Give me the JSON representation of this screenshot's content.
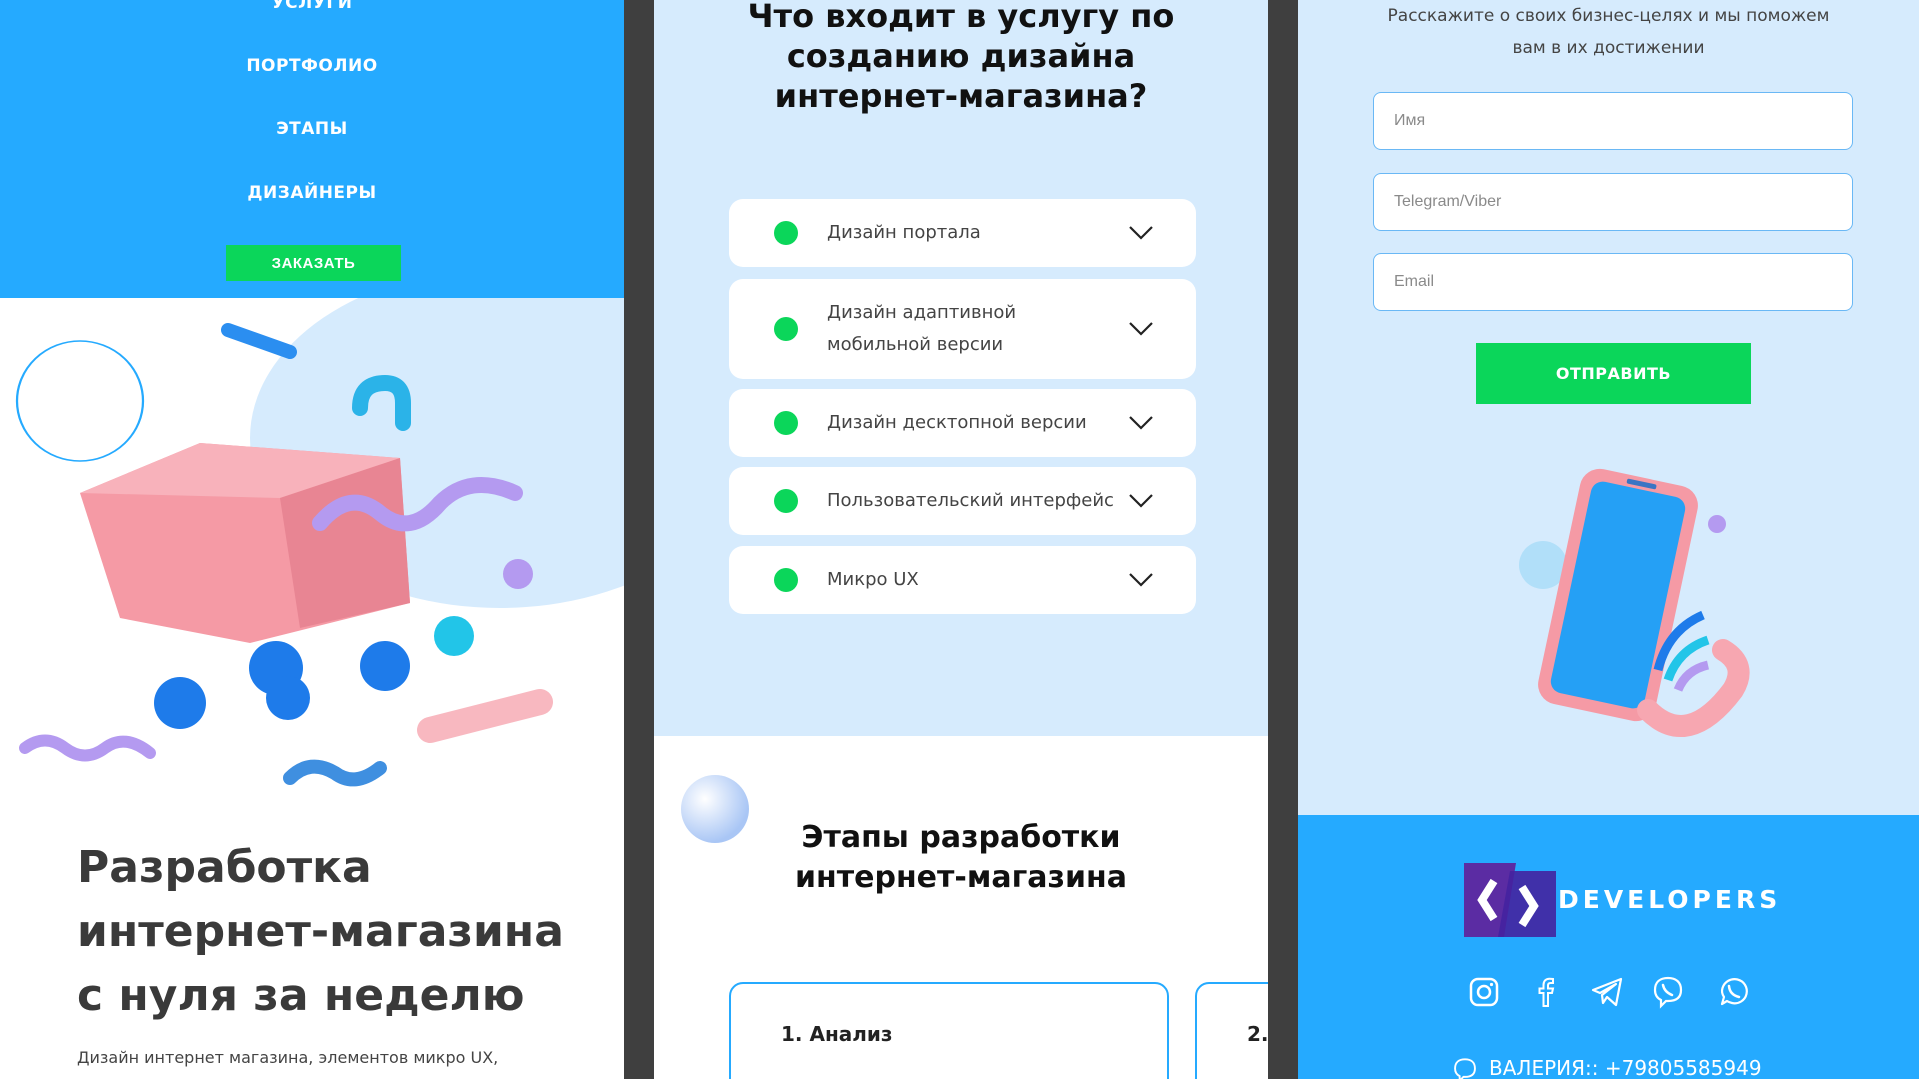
{
  "panel1": {
    "nav": [
      "УСЛУГИ",
      "ПОРТФОЛИО",
      "ЭТАПЫ",
      "ДИЗАЙНЕРЫ"
    ],
    "order_button": "ЗАКАЗАТЬ",
    "hero_title": [
      "Разработка",
      "интернет-магазина",
      "с нуля за неделю"
    ],
    "hero_subtitle": "Дизайн интернет магазина, элементов микро UX,"
  },
  "panel2": {
    "title": [
      "Что входит в услугу по",
      "созданию дизайна",
      "интернет-магазина?"
    ],
    "services": [
      [
        "Дизайн портала"
      ],
      [
        "Дизайн адаптивной",
        "мобильной версии"
      ],
      [
        "Дизайн десктопной версии"
      ],
      [
        "Пользовательский интерфейс"
      ],
      [
        "Микро UX"
      ]
    ],
    "stages_title": [
      "Этапы разработки",
      "интернет-магазина"
    ],
    "stages": [
      "1. Анализ",
      "2."
    ]
  },
  "panel3": {
    "intro": [
      "Расскажите о своих бизнес-целях и мы поможем",
      "вам в их достижении"
    ],
    "form": {
      "name_placeholder": "Имя",
      "messenger_placeholder": "Telegram/Viber",
      "email_placeholder": "Email",
      "submit": "ОТПРАВИТЬ"
    },
    "logo_text": "DEVELOPERS",
    "social_icons": [
      "instagram-icon",
      "facebook-icon",
      "telegram-icon",
      "viber-icon",
      "whatsapp-icon"
    ],
    "contact": "ВАЛЕРИЯ:: +79805585949"
  },
  "colors": {
    "primary_blue": "#25aaff",
    "light_blue": "#d6ebfd",
    "green": "#0bd65a",
    "logo_purple": "#5b2ca3"
  }
}
